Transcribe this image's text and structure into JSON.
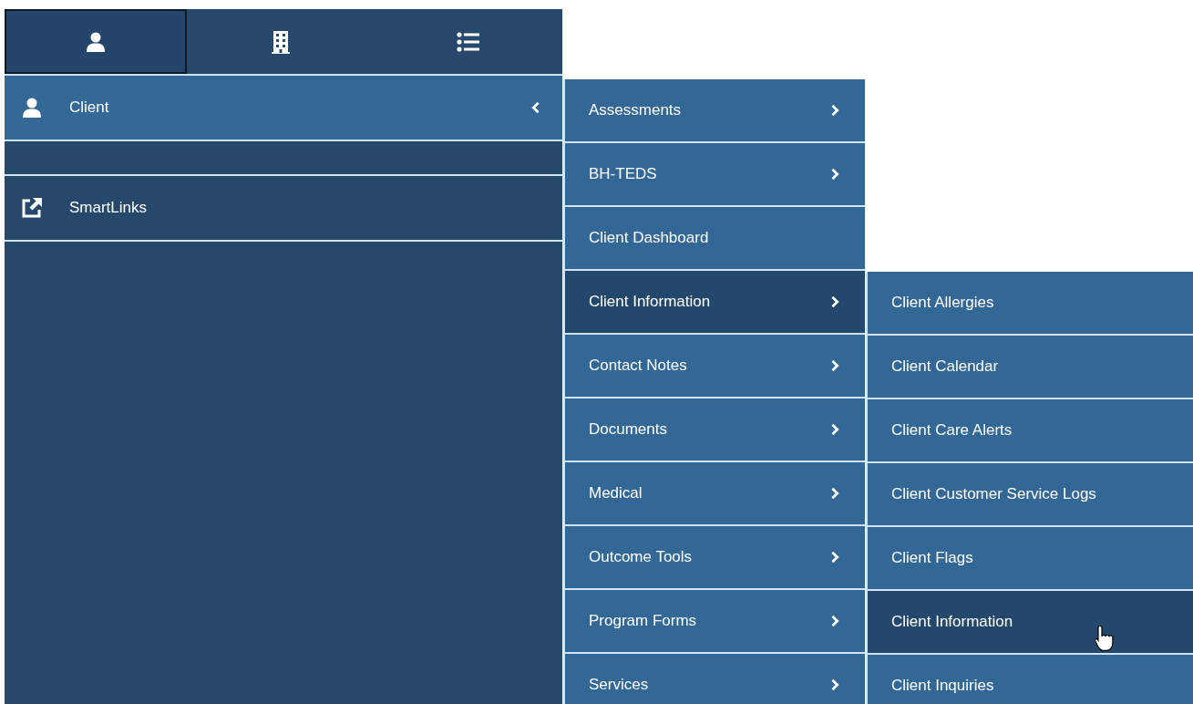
{
  "tabs": [
    {
      "selected": true
    },
    {
      "selected": false
    },
    {
      "selected": false
    }
  ],
  "sidebar": {
    "items": [
      {
        "kind": "person",
        "label": "Client",
        "selected": true,
        "expanded": true
      },
      {
        "kind": "spacer"
      },
      {
        "kind": "link",
        "label": "SmartLinks",
        "selected": false,
        "expanded": false
      }
    ]
  },
  "submenu": {
    "items": [
      {
        "label": "Assessments",
        "has_children": true,
        "selected": false
      },
      {
        "label": "BH-TEDS",
        "has_children": true,
        "selected": false
      },
      {
        "label": "Client Dashboard",
        "has_children": false,
        "selected": false
      },
      {
        "label": "Client Information",
        "has_children": true,
        "selected": true
      },
      {
        "label": "Contact Notes",
        "has_children": true,
        "selected": false
      },
      {
        "label": "Documents",
        "has_children": true,
        "selected": false
      },
      {
        "label": "Medical",
        "has_children": true,
        "selected": false
      },
      {
        "label": "Outcome Tools",
        "has_children": true,
        "selected": false
      },
      {
        "label": "Program Forms",
        "has_children": true,
        "selected": false
      },
      {
        "label": "Services",
        "has_children": true,
        "selected": false
      }
    ]
  },
  "submenu_2": {
    "items": [
      {
        "label": "Client Allergies",
        "selected": false
      },
      {
        "label": "Client Calendar",
        "selected": false
      },
      {
        "label": "Client Care Alerts",
        "selected": false
      },
      {
        "label": "Client Customer Service Logs",
        "selected": false
      },
      {
        "label": "Client Flags",
        "selected": false
      },
      {
        "label": "Client Information",
        "selected": true
      },
      {
        "label": "Client Inquiries",
        "selected": false
      }
    ]
  }
}
